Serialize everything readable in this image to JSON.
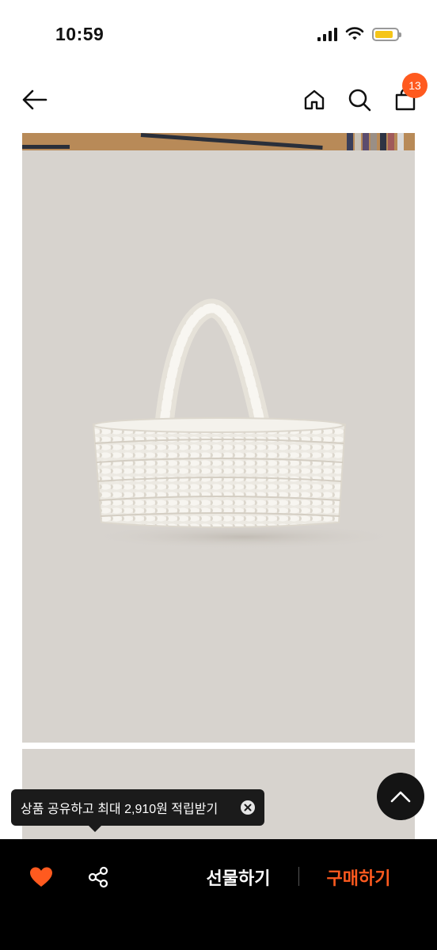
{
  "status_bar": {
    "time": "10:59",
    "battery_level": 0.85,
    "battery_color": "#f5c518"
  },
  "nav": {
    "back_icon": "arrow-left-icon",
    "home_icon": "home-icon",
    "search_icon": "search-icon",
    "cart_icon": "shopping-bag-icon",
    "cart_count": "13",
    "badge_color": "#ff5a1f"
  },
  "product": {
    "image_subject": "woven white raffia tote bag",
    "image_background": "#d7d3ce"
  },
  "tooltip": {
    "text": "상품 공유하고 최대 2,910원 적립받기",
    "close_icon": "close-circle-icon"
  },
  "scroll_top": {
    "icon": "chevron-up-icon"
  },
  "bottom_bar": {
    "like_icon": "heart-icon",
    "like_color": "#ff5a1f",
    "share_icon": "share-icon",
    "gift_label": "선물하기",
    "buy_label": "구매하기",
    "buy_color": "#ff5a1f"
  }
}
